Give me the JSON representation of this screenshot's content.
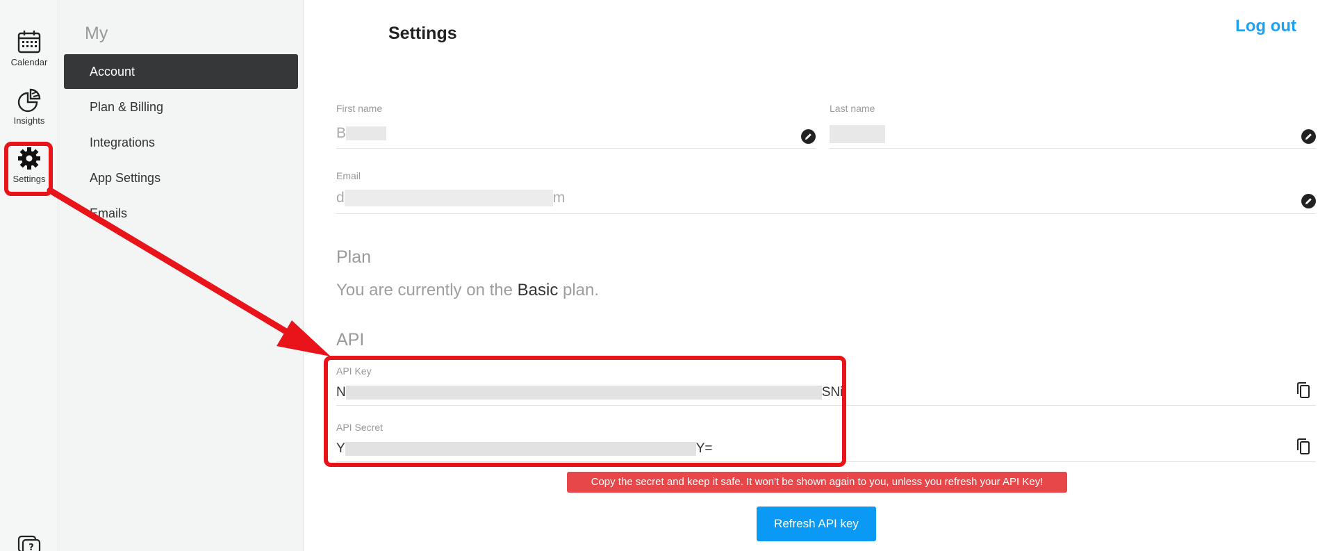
{
  "rail": {
    "items": [
      {
        "label": "Calendar",
        "icon": "calendar-icon"
      },
      {
        "label": "Insights",
        "icon": "pie-chart-icon"
      },
      {
        "label": "Settings",
        "icon": "gear-icon"
      }
    ],
    "help_icon": "help-chat-icon"
  },
  "sidebar": {
    "title_prefix": "My",
    "title": "Settings",
    "items": [
      {
        "label": "Account"
      },
      {
        "label": "Plan & Billing"
      },
      {
        "label": "Integrations"
      },
      {
        "label": "App Settings"
      },
      {
        "label": "Emails"
      }
    ]
  },
  "header": {
    "logout_label": "Log out"
  },
  "account": {
    "first_name_label": "First name",
    "first_name_visible": "B",
    "last_name_label": "Last name",
    "last_name_visible": "",
    "email_label": "Email",
    "email_start": "d",
    "email_end": "m"
  },
  "plan": {
    "heading": "Plan",
    "text_before": "You are currently on the",
    "plan_name": "Basic",
    "text_after": "plan."
  },
  "api": {
    "heading": "API",
    "key_label": "API Key",
    "key_start": "N",
    "key_end": "SNi",
    "secret_label": "API Secret",
    "secret_start": "Y",
    "secret_end": "Y="
  },
  "warning": "Copy the secret and keep it safe. It won't be shown again to you, unless you refresh your API Key!",
  "refresh_button_label": "Refresh API key",
  "colors": {
    "accent": "#1ea1f2",
    "button": "#0a9af5",
    "warning": "#e8474a",
    "annotation": "#e8141a",
    "active_nav": "#353738"
  }
}
